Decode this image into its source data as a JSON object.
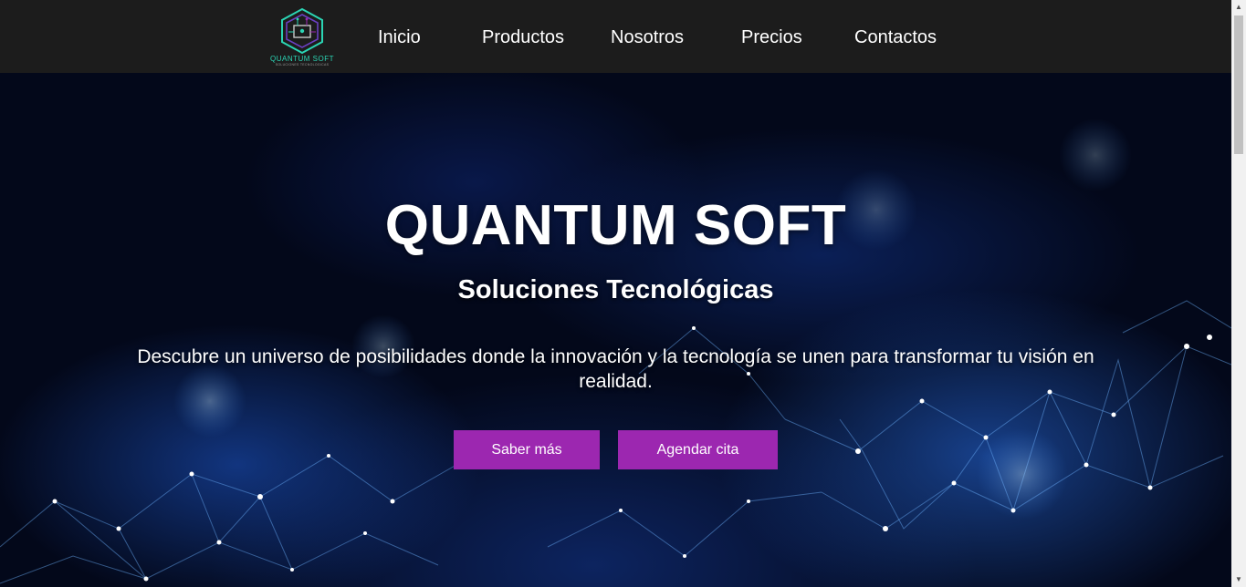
{
  "brand": {
    "name": "QUANTUM SOFT",
    "tagline": "SOLUCIONES TECNOLOGICAS",
    "logo_icon": "circuit-hexagon-logo",
    "accent": "#2bd4b4"
  },
  "nav": {
    "items": [
      {
        "label": "Inicio"
      },
      {
        "label": "Productos"
      },
      {
        "label": "Nosotros"
      },
      {
        "label": "Precios"
      },
      {
        "label": "Contactos"
      }
    ],
    "background": "#1c1c1c"
  },
  "hero": {
    "title": "QUANTUM SOFT",
    "subtitle": "Soluciones Tecnológicas",
    "description": "Descubre un universo de posibilidades donde la innovación y la tecnología se unen para transformar tu visión en realidad.",
    "primary_button": "Saber más",
    "secondary_button": "Agendar cita",
    "button_color": "#9c27b0"
  },
  "scrollbar": {
    "up_icon": "chevron-up-icon",
    "down_icon": "chevron-down-icon"
  }
}
